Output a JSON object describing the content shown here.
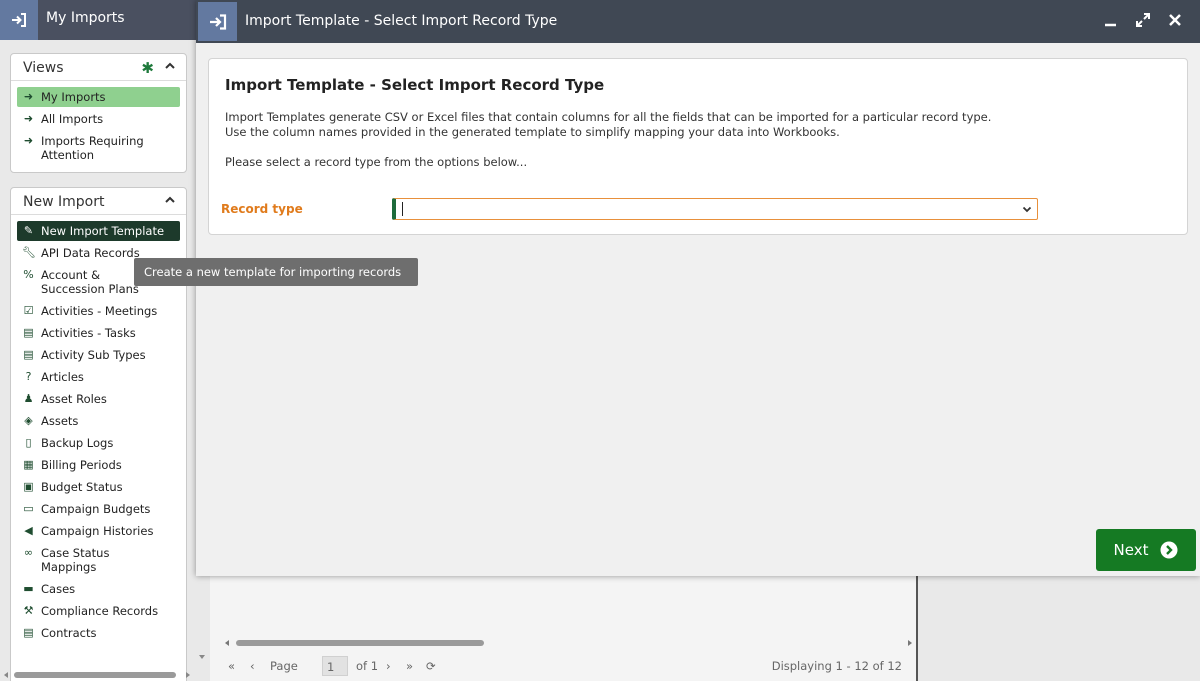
{
  "background": {
    "tab_title": "My Imports",
    "views_panel": {
      "title": "Views",
      "items": [
        {
          "label": "My Imports",
          "icon": "sign-in-icon",
          "selected": true
        },
        {
          "label": "All Imports",
          "icon": "sign-in-icon"
        },
        {
          "label": "Imports Requiring Attention",
          "icon": "sign-in-icon"
        }
      ]
    },
    "new_import_panel": {
      "title": "New Import",
      "items": [
        {
          "label": "New Import Template",
          "icon": "edit-icon",
          "selected": true
        },
        {
          "label": "API Data Records",
          "icon": "wrench-icon"
        },
        {
          "label": "Account & Succession Plans",
          "icon": "percent-icon"
        },
        {
          "label": "Activities - Meetings",
          "icon": "calendar-check-icon"
        },
        {
          "label": "Activities - Tasks",
          "icon": "clipboard-check-icon"
        },
        {
          "label": "Activity Sub Types",
          "icon": "clipboard-check-icon"
        },
        {
          "label": "Articles",
          "icon": "question-circle-icon"
        },
        {
          "label": "Asset Roles",
          "icon": "users-icon"
        },
        {
          "label": "Assets",
          "icon": "cube-icon"
        },
        {
          "label": "Backup Logs",
          "icon": "file-archive-icon"
        },
        {
          "label": "Billing Periods",
          "icon": "calendar-icon"
        },
        {
          "label": "Budget Status",
          "icon": "budget-icon"
        },
        {
          "label": "Campaign Budgets",
          "icon": "money-bill-icon"
        },
        {
          "label": "Campaign Histories",
          "icon": "bullhorn-icon"
        },
        {
          "label": "Case Status Mappings",
          "icon": "link-icon"
        },
        {
          "label": "Cases",
          "icon": "briefcase-icon"
        },
        {
          "label": "Compliance Records",
          "icon": "gavel-icon"
        },
        {
          "label": "Contracts",
          "icon": "file-contract-icon"
        }
      ]
    },
    "tooltip": "Create a new template for importing records",
    "pager": {
      "page_label": "Page",
      "page_value": "1",
      "of_label": "of 1",
      "display_text": "Displaying 1 - 12 of 12"
    }
  },
  "modal": {
    "window_title": "Import Template - Select Import Record Type",
    "heading": "Import Template - Select Import Record Type",
    "description_line1": "Import Templates generate CSV or Excel files that contain columns for all the fields that can be imported for a particular record type.",
    "description_line2": "Use the column names provided in the generated template to simplify mapping your data into Workbooks.",
    "prompt": "Please select a record type from the options below...",
    "field_label": "Record type",
    "field_value": "",
    "next_label": "Next"
  },
  "colors": {
    "accent_green": "#157a23",
    "label_orange": "#e07b1c",
    "titlebar": "#404854",
    "tab_icon_blue": "#6379a0"
  }
}
